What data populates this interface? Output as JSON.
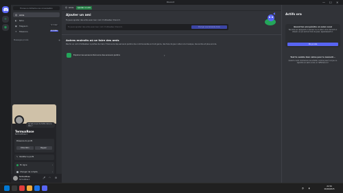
{
  "window": {
    "title": "Discord",
    "controls": [
      "—",
      "☐",
      "✕"
    ]
  },
  "sidebar": {
    "search_placeholder": "Trouve ou démarre une conversation",
    "items": [
      {
        "label": "Amis",
        "icon": "friends-icon",
        "active": true
      },
      {
        "label": "Nitro",
        "icon": "nitro-icon"
      },
      {
        "label": "Magasin",
        "icon": "shop-icon",
        "badge": "NOUVEAU"
      },
      {
        "label": "Missions",
        "icon": "quests-icon",
        "badge": "NOUVEAU"
      }
    ],
    "dm_header": "Messages privés"
  },
  "profile_popout": {
    "status_text": "Qu'est-ce qui te trotte dans la tête ?",
    "display_name": "TermuxRose",
    "username": "termuxRose.1",
    "box_title": "Présence du profil",
    "btn_edit": "Éditer Nitro",
    "btn_badges": "Magasin",
    "edit_profile": "Modifier le profil",
    "status_online": "En ligne",
    "switch_account": "Changer de compte"
  },
  "userbar": {
    "name": "TermuxRose",
    "status": "termuxRose.1"
  },
  "topbar": {
    "friends_label": "Amis",
    "add_friend_tab": "Ajouter un ami"
  },
  "add_friend": {
    "title": "Ajouter un ami",
    "subtitle": "Tu peux ajouter des amis avec leur nom d'utilisateur Discord.",
    "input_placeholder": "Tu peux ajouter des amis avec leur nom d'utilisateur Discord.",
    "send_button": "Envoyer une demande d'ami"
  },
  "other_places": {
    "title": "Autres endroits où se faire des amis",
    "subtitle": "Pas toi un nom d'utilisateur à portée de main ? Découvre des serveurs publics des communautés en tout genre, des fans de jeux vidéo à la musique, des anime et plus encore.",
    "explore_label": "Explorer les serveurs Découvre des serveurs publics"
  },
  "activity": {
    "title": "Actifs ora",
    "card_title": "Quand ton ami pénètre un salon vocal",
    "card_body": "Tes amis qui rejoignent un serveur ou un salon vocal, lancent un stream, ou qui sont en train de jouer, apparaissent ici.",
    "card_button": "Ok, je vois",
    "quiet_title": "Tout te semble bien calme pour le moment...",
    "quiet_body": "Quand un ami commence une activité, comme jouer à un jeu ou rejoindre un salon vocal, on l'affichera ici !"
  },
  "taskbar": {
    "time": "21:56",
    "date": "26/04/2025"
  },
  "colors": {
    "blurple": "#5865f2",
    "green": "#23a55a",
    "bg": "#313338"
  }
}
